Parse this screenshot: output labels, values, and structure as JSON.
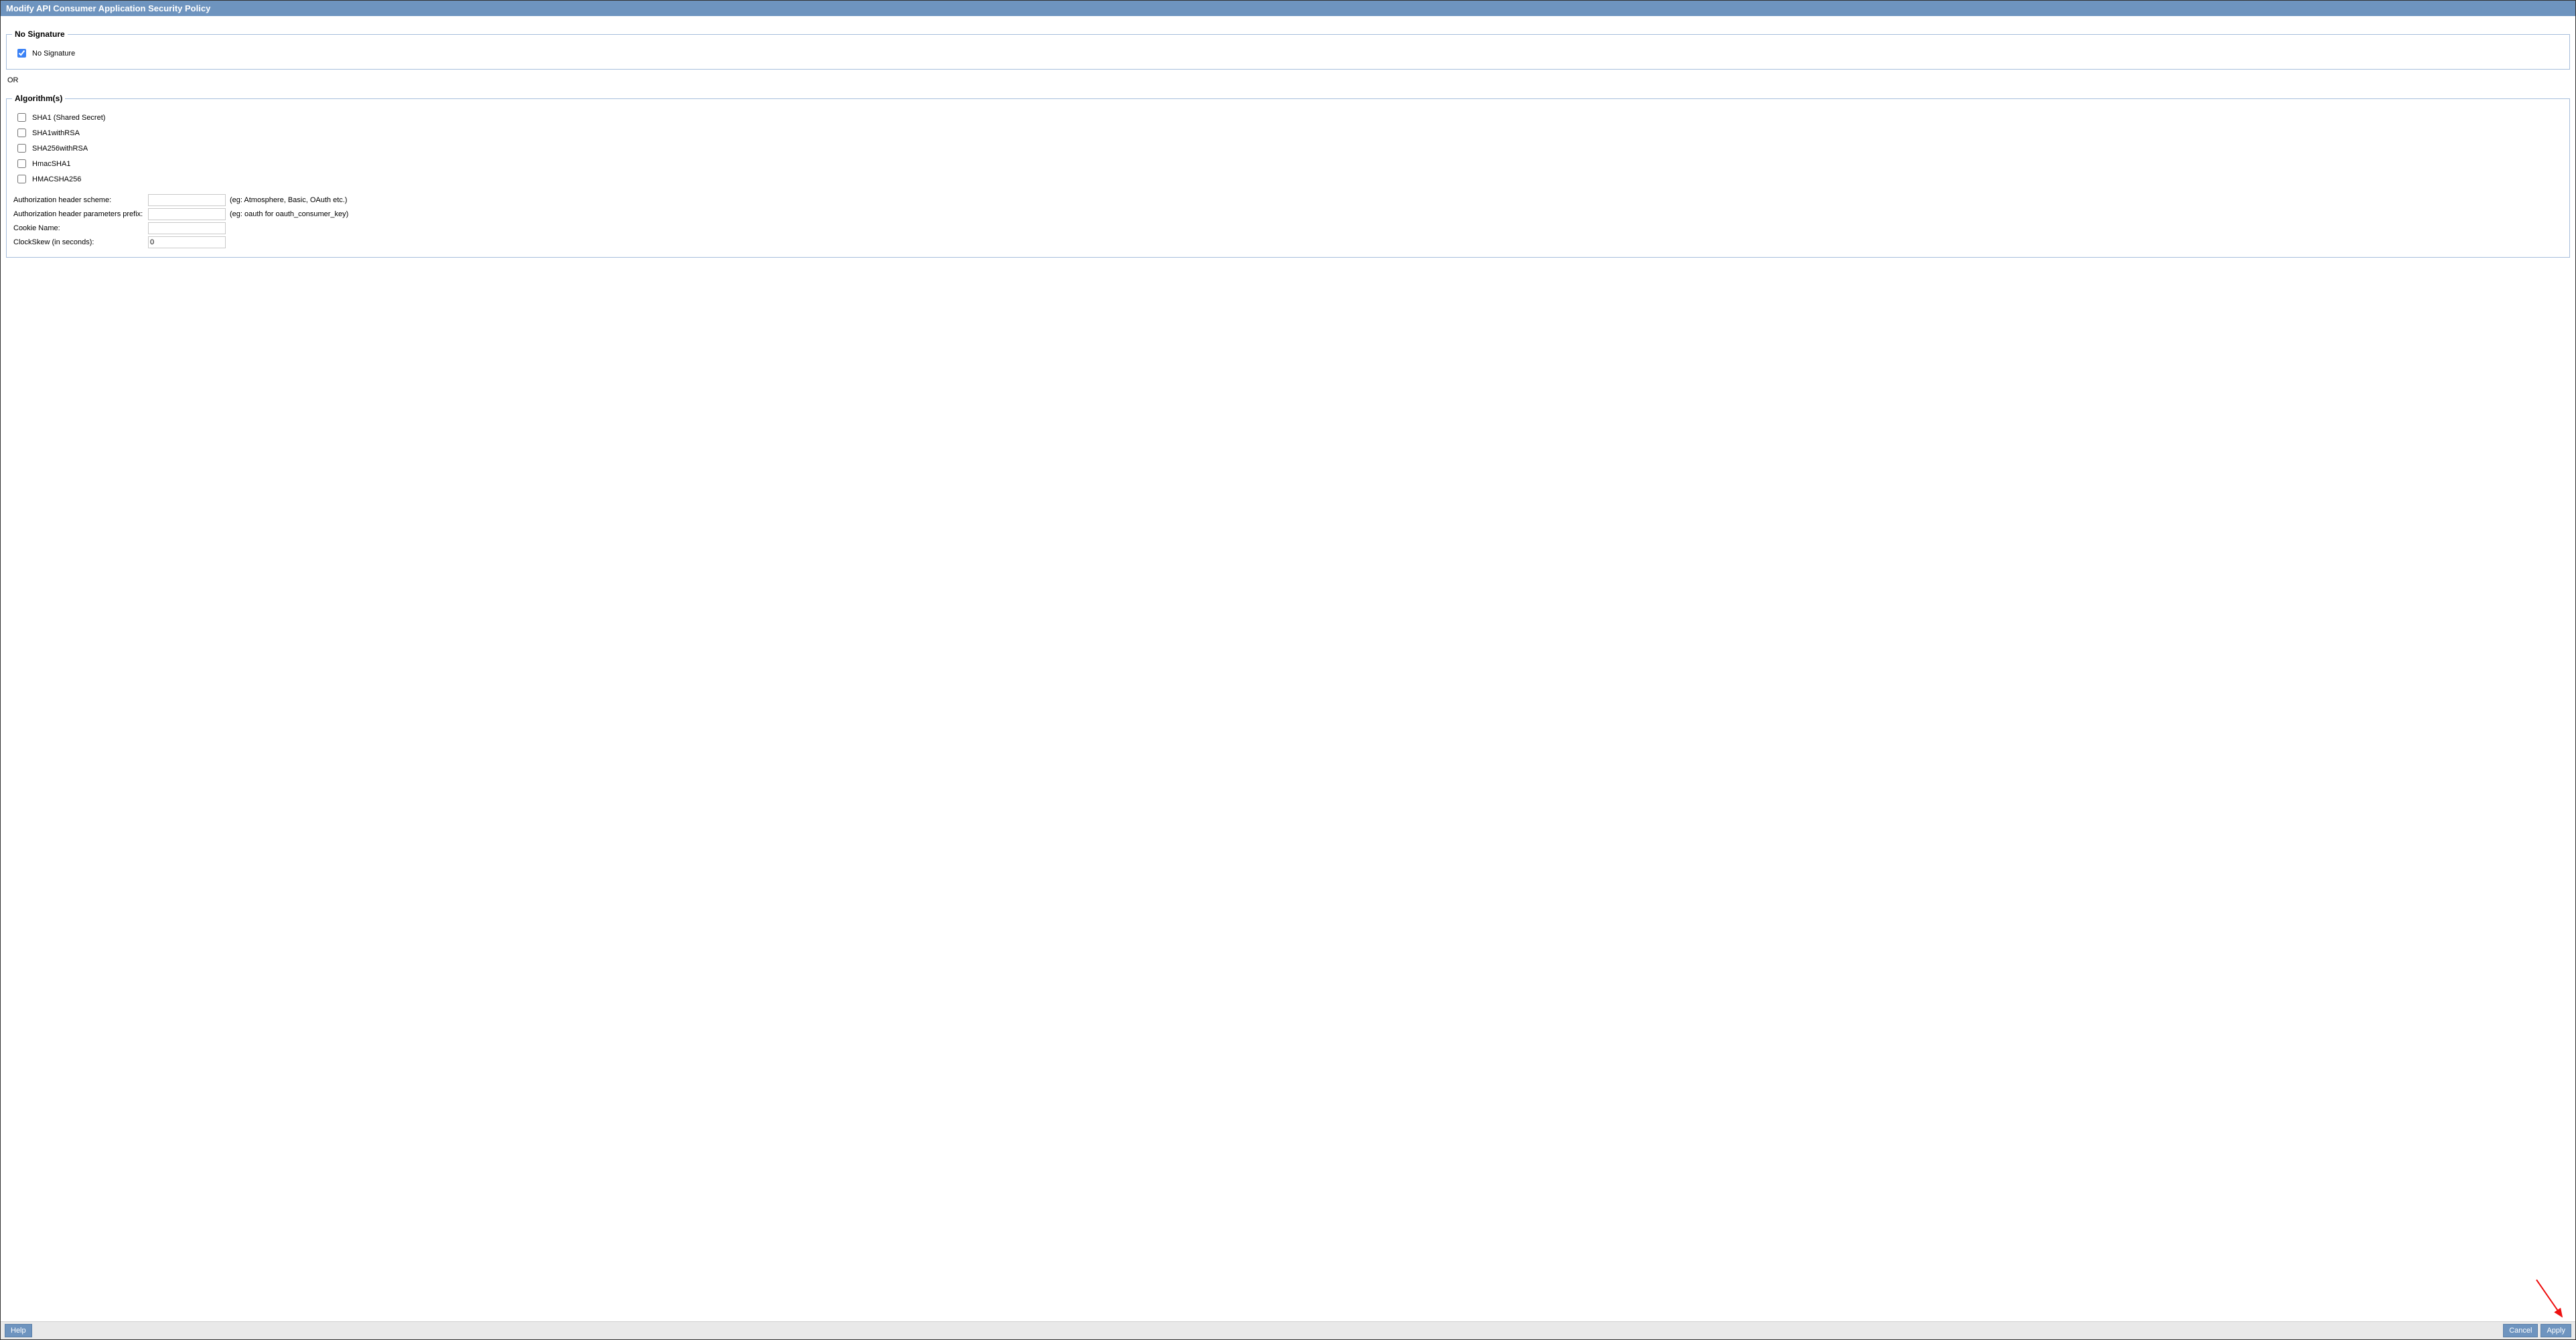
{
  "title": "Modify API Consumer Application Security Policy",
  "noSignature": {
    "legend": "No Signature",
    "checkboxLabel": "No Signature",
    "checked": true
  },
  "orText": "OR",
  "algorithms": {
    "legend": "Algorithm(s)",
    "options": [
      {
        "id": "sha1-shared",
        "label": "SHA1 (Shared Secret)",
        "checked": false
      },
      {
        "id": "sha1withrsa",
        "label": "SHA1withRSA",
        "checked": false
      },
      {
        "id": "sha256withrsa",
        "label": "SHA256withRSA",
        "checked": false
      },
      {
        "id": "hmacsha1",
        "label": "HmacSHA1",
        "checked": false
      },
      {
        "id": "hmacsha256",
        "label": "HMACSHA256",
        "checked": false
      }
    ],
    "fields": {
      "authHeaderScheme": {
        "label": "Authorization header scheme:",
        "value": "",
        "hint": "(eg: Atmosphere, Basic, OAuth etc.)"
      },
      "authHeaderPrefix": {
        "label": "Authorization header parameters prefix:",
        "value": "",
        "hint": "(eg: oauth for oauth_consumer_key)"
      },
      "cookieName": {
        "label": "Cookie Name:",
        "value": ""
      },
      "clockSkew": {
        "label": "ClockSkew (in seconds):",
        "value": "0"
      }
    }
  },
  "footer": {
    "help": "Help",
    "cancel": "Cancel",
    "apply": "Apply"
  }
}
